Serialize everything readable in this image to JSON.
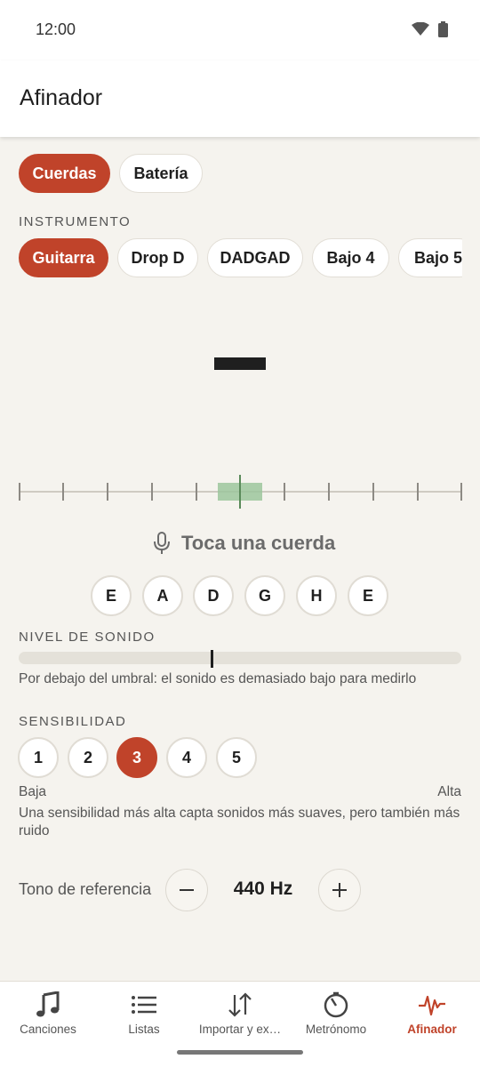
{
  "status_bar": {
    "time": "12:00",
    "icons": [
      "wifi-icon",
      "battery-icon"
    ]
  },
  "app_bar": {
    "title": "Afinador"
  },
  "mode_tabs": [
    {
      "label": "Cuerdas",
      "selected": true
    },
    {
      "label": "Batería",
      "selected": false
    }
  ],
  "instrument": {
    "section_label": "INSTRUMENTO",
    "options": [
      {
        "label": "Guitarra",
        "selected": true
      },
      {
        "label": "Drop D",
        "selected": false
      },
      {
        "label": "DADGAD",
        "selected": false
      },
      {
        "label": "Bajo 4",
        "selected": false
      },
      {
        "label": "Bajo 5",
        "selected": false
      }
    ]
  },
  "tuner": {
    "note_display": "—",
    "prompt": "Toca una cuerda",
    "prompt_icon": "microphone-icon",
    "strings": [
      "E",
      "A",
      "D",
      "G",
      "H",
      "E"
    ]
  },
  "sound_level": {
    "section_label": "NIVEL DE SONIDO",
    "level": 0.44,
    "message": "Por debajo del umbral: el sonido es demasiado bajo para medirlo"
  },
  "sensitivity": {
    "section_label": "SENSIBILIDAD",
    "options": [
      "1",
      "2",
      "3",
      "4",
      "5"
    ],
    "selected": "3",
    "low_label": "Baja",
    "high_label": "Alta",
    "description": "Una sensibilidad más alta capta sonidos más suaves, pero también más ruido"
  },
  "reference": {
    "label": "Tono de referencia",
    "value": "440 Hz",
    "decrease_icon": "minus-icon",
    "increase_icon": "plus-icon"
  },
  "bottom_nav": [
    {
      "label": "Canciones",
      "icon": "music-note-icon",
      "active": false
    },
    {
      "label": "Listas",
      "icon": "list-icon",
      "active": false
    },
    {
      "label": "Importar y ex…",
      "icon": "import-export-icon",
      "active": false
    },
    {
      "label": "Metrónomo",
      "icon": "metronome-icon",
      "active": false
    },
    {
      "label": "Afinador",
      "icon": "tuner-wave-icon",
      "active": true
    }
  ],
  "colors": {
    "accent": "#c0432a",
    "background": "#f5f3ee",
    "in_tune_zone": "#9cc59c"
  }
}
